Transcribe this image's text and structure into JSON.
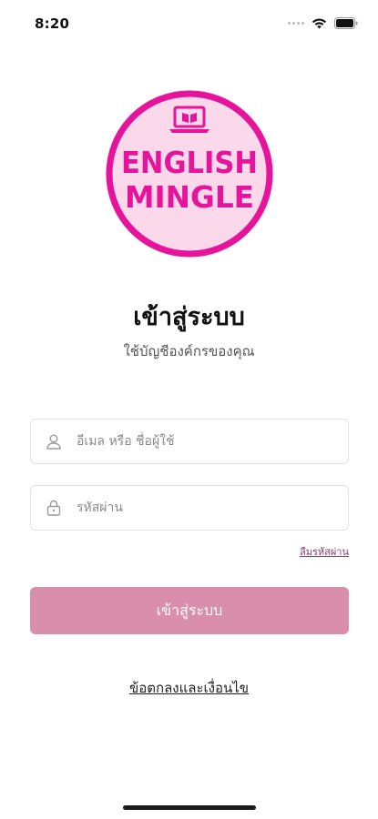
{
  "status_bar": {
    "time": "8:20"
  },
  "logo": {
    "line1": "ENGLISH",
    "line2": "MINGLE",
    "brand_color": "#e6139b",
    "fill_color": "#fbd9ea"
  },
  "login": {
    "title": "เข้าสู่ระบบ",
    "subtitle": "ใช้บัญชีองค์กรของคุณ",
    "email_placeholder": "อีเมล หรือ ชื่อผู้ใช้",
    "password_placeholder": "รหัสผ่าน",
    "forgot_password": "ลืมรหัสผ่าน",
    "submit_label": "เข้าสู่ระบบ",
    "terms_link": "ข้อตกลงและเงื่อนไข"
  },
  "colors": {
    "button": "#d98fab",
    "link": "#8a3b6a"
  }
}
